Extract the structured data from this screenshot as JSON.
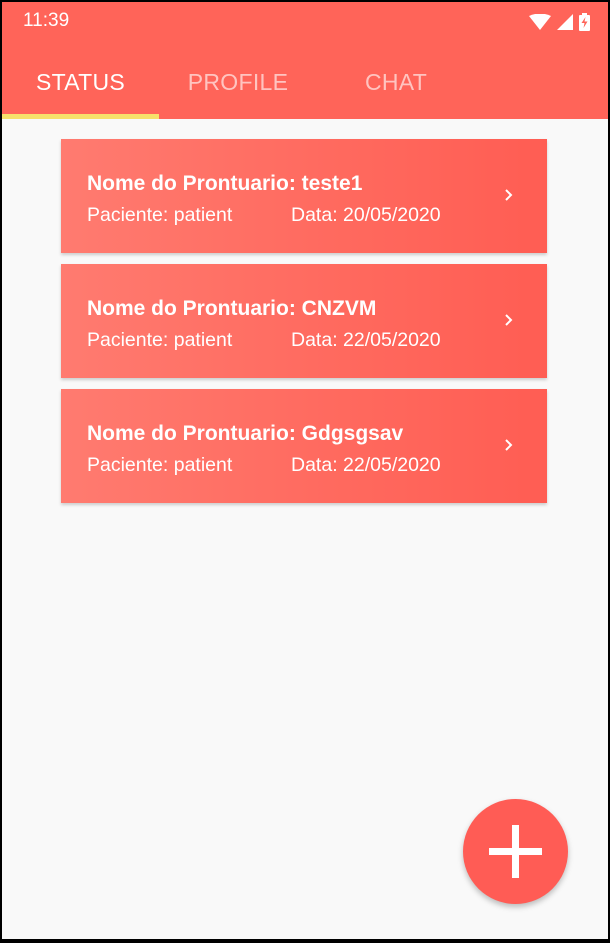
{
  "status_bar": {
    "time": "11:39",
    "icons": [
      "wifi-icon",
      "signal-icon",
      "battery-charging-icon"
    ]
  },
  "tabs": [
    {
      "label": "STATUS",
      "active": true
    },
    {
      "label": "PROFILE",
      "active": false
    },
    {
      "label": "CHAT",
      "active": false
    }
  ],
  "records": [
    {
      "title": "Nome do Prontuario: teste1",
      "patient": "Paciente: patient",
      "date": "Data: 20/05/2020"
    },
    {
      "title": "Nome do Prontuario: CNZVM",
      "patient": "Paciente: patient",
      "date": "Data: 22/05/2020"
    },
    {
      "title": "Nome do Prontuario: Gdgsgsav",
      "patient": "Paciente: patient",
      "date": "Data: 22/05/2020"
    }
  ],
  "fab": {
    "icon": "plus-icon"
  },
  "colors": {
    "primary": "#ff6459",
    "indicator": "#f7e16b",
    "background": "#f9f9f9",
    "card": "#ff6a5f"
  }
}
